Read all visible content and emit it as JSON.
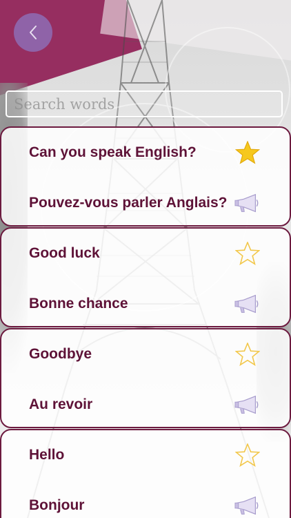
{
  "header": {
    "back_icon": "chevron-left-icon"
  },
  "search": {
    "placeholder": "Search words",
    "value": ""
  },
  "phrases": [
    {
      "english": "Can you speak English?",
      "french": "Pouvez-vous parler Anglais?",
      "favorite": true
    },
    {
      "english": "Good luck",
      "french": "Bonne chance",
      "favorite": false
    },
    {
      "english": "Goodbye",
      "french": "Au revoir",
      "favorite": false
    },
    {
      "english": "Hello",
      "french": "Bonjour",
      "favorite": false
    }
  ],
  "icons": {
    "favorite_on": "star-filled-icon",
    "favorite_off": "star-outline-icon",
    "speak": "megaphone-icon"
  },
  "colors": {
    "accent": "#8f63a8",
    "card_border": "#6c1a3f",
    "text": "#5e1237",
    "star_filled": "#f6c81e",
    "star_outline": "#f2c74a",
    "megaphone": "#c9bfe3"
  }
}
